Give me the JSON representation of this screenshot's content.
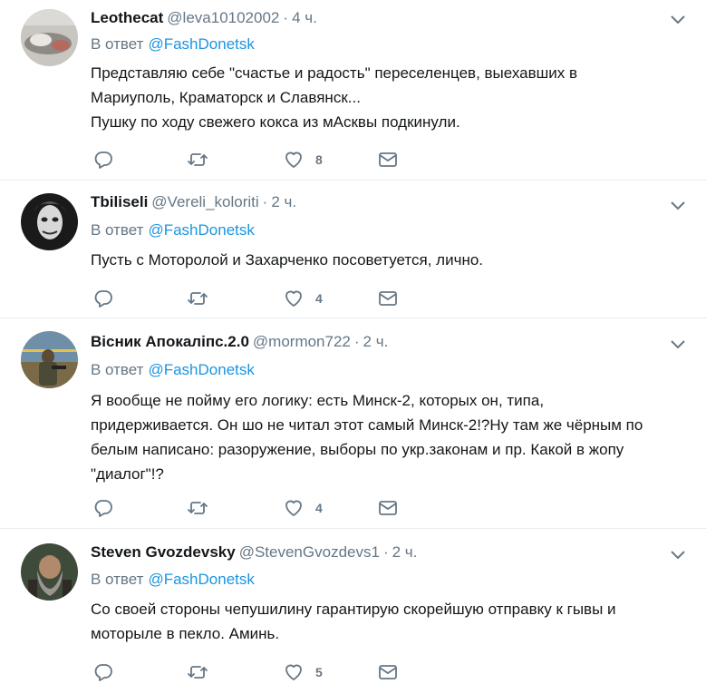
{
  "tweets": [
    {
      "name": "Leothecat",
      "handle": "@leva10102002",
      "time": "4 ч.",
      "reply_prefix": "В ответ",
      "reply_to": "@FashDonetsk",
      "text": "Представляю себе \"счастье и радость\" переселенцев, выехавших в\nМариуполь, Краматорск и Славянск...\nПушку по ходу свежего кокса из мАсквы подкинули.",
      "likes": "8"
    },
    {
      "name": "Tbiliseli",
      "handle": "@Vereli_koloriti",
      "time": "2 ч.",
      "reply_prefix": "В ответ",
      "reply_to": "@FashDonetsk",
      "text": "Пусть с Моторолой и Захарченко посоветуется, лично.",
      "likes": "4"
    },
    {
      "name": "Вісник Апокаліпс.2.0",
      "handle": "@mormon722",
      "time": "2 ч.",
      "reply_prefix": "В ответ",
      "reply_to": "@FashDonetsk",
      "text": "Я вообще не пойму его логику: есть Минск-2, которых он, типа,\nпридерживается. Он шо не читал этот самый Минск-2!?Ну там же чёрным по\nбелым написано: разоружение, выборы по укр.законам  и пр. Какой в жопу\n\"диалог\"!?",
      "likes": "4"
    },
    {
      "name": "Steven Gvozdevsky",
      "handle": "@StevenGvozdevs1",
      "time": "2 ч.",
      "reply_prefix": "В ответ",
      "reply_to": "@FashDonetsk",
      "text": "Со своей стороны чепушилину гарантирую скорейшую отправку к гывы и\nмоторыле в пекло. Аминь.",
      "likes": "5"
    }
  ],
  "icons": {
    "reply": "reply-icon",
    "retweet": "retweet-icon",
    "like": "heart-icon",
    "message": "envelope-icon",
    "more": "chevron-down-icon"
  },
  "colors": {
    "link": "#1b95e0",
    "muted": "#657786",
    "text": "#14171a",
    "divider": "#e6ecf0"
  }
}
